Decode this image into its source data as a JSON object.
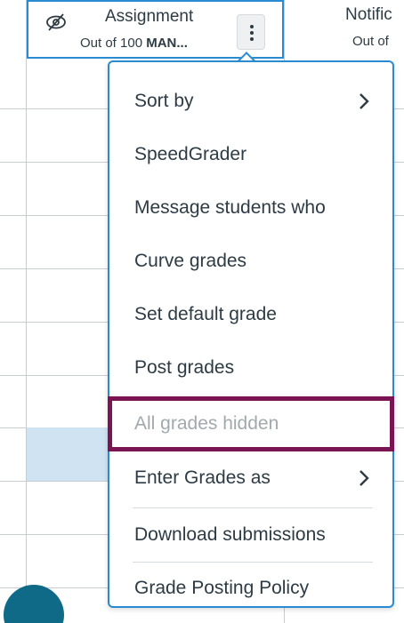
{
  "header": {
    "column_title": "Assignment",
    "column_sub_prefix": "Out of 100",
    "column_sub_bold": "MAN...",
    "next_column_title": "Notific",
    "next_column_sub": "Out of"
  },
  "menu": {
    "items": [
      {
        "label": "Sort by",
        "has_submenu": true
      },
      {
        "label": "SpeedGrader"
      },
      {
        "label": "Message students who"
      },
      {
        "label": "Curve grades"
      },
      {
        "label": "Set default grade"
      },
      {
        "label": "Post grades"
      },
      {
        "label": "All grades hidden",
        "disabled": true
      },
      {
        "label": "Enter Grades as",
        "has_submenu": true
      },
      {
        "label": "Download submissions"
      },
      {
        "label": "Grade Posting Policy"
      }
    ]
  },
  "colors": {
    "accent": "#2a8bd0",
    "highlight": "#7a1453",
    "selected_row": "#cfe3f3",
    "disabled_text": "#a2a9ad"
  },
  "icons": {
    "hidden": "eye-slash-icon",
    "options": "kebab-icon",
    "submenu": "chevron-right-icon"
  }
}
